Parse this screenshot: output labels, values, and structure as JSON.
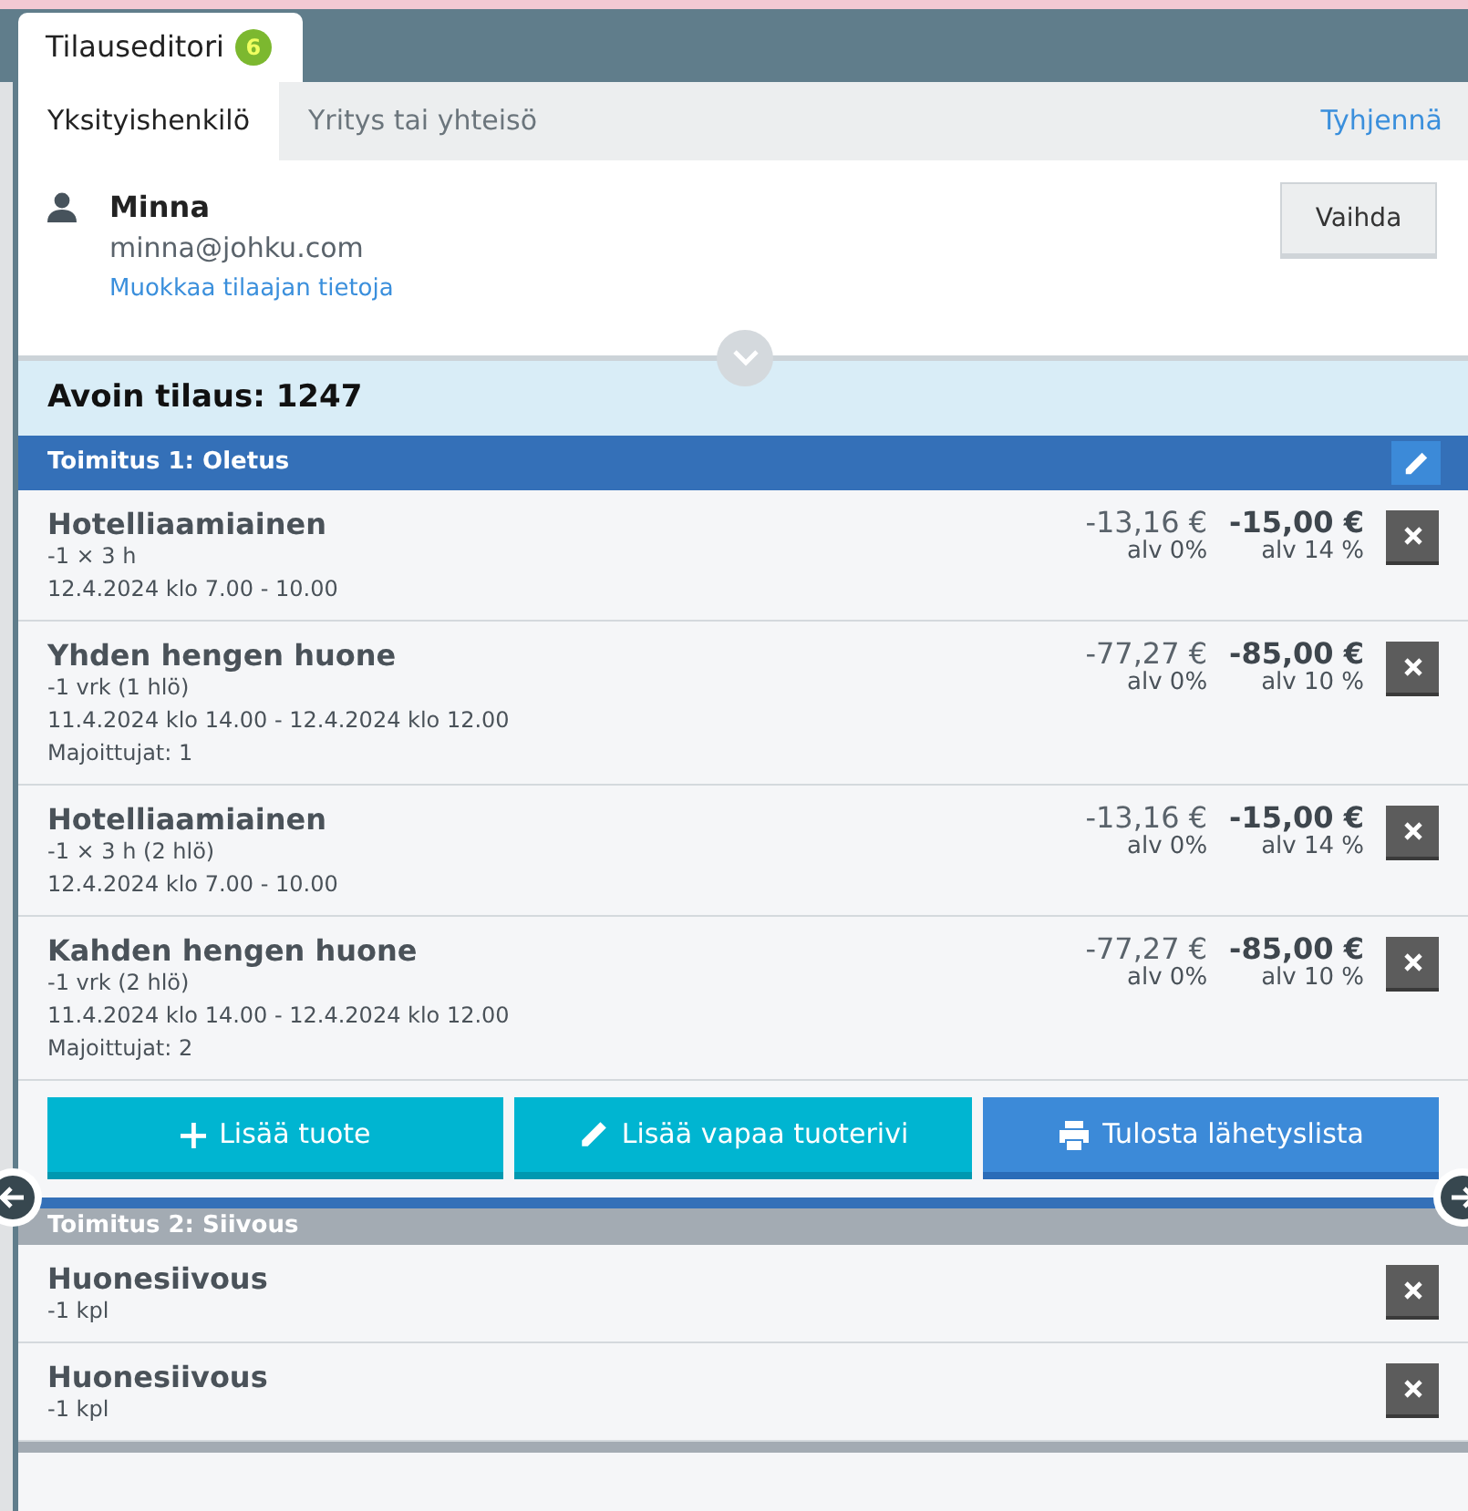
{
  "window_tab": {
    "title": "Tilauseditori",
    "badge": "6"
  },
  "customer_tabs": [
    {
      "label": "Yksityishenkilö",
      "selected": true
    },
    {
      "label": "Yritys tai yhteisö",
      "selected": false
    }
  ],
  "clear_link": "Tyhjennä",
  "customer": {
    "name": "Minna",
    "email": "minna@johku.com",
    "edit_link": "Muokkaa tilaajan tietoja",
    "change_button": "Vaihda"
  },
  "order_title": "Avoin tilaus: 1247",
  "deliveries": [
    {
      "title": "Toimitus 1: Oletus",
      "active": true,
      "items": [
        {
          "name": "Hotelliaamiainen",
          "details": [
            "-1 × 3 h",
            "12.4.2024 klo 7.00 - 10.00"
          ],
          "net_price": "-13,16 €",
          "net_vat": "alv 0%",
          "gross_price": "-15,00 €",
          "gross_vat": "alv 14 %"
        },
        {
          "name": "Yhden hengen huone",
          "details": [
            "-1 vrk (1 hlö)",
            "11.4.2024 klo 14.00 - 12.4.2024 klo 12.00",
            "Majoittujat: 1"
          ],
          "net_price": "-77,27 €",
          "net_vat": "alv 0%",
          "gross_price": "-85,00 €",
          "gross_vat": "alv 10 %"
        },
        {
          "name": "Hotelliaamiainen",
          "details": [
            "-1 × 3 h (2 hlö)",
            "12.4.2024 klo 7.00 - 10.00"
          ],
          "net_price": "-13,16 €",
          "net_vat": "alv 0%",
          "gross_price": "-15,00 €",
          "gross_vat": "alv 14 %"
        },
        {
          "name": "Kahden hengen huone",
          "details": [
            "-1 vrk (2 hlö)",
            "11.4.2024 klo 14.00 - 12.4.2024 klo 12.00",
            "Majoittujat: 2"
          ],
          "net_price": "-77,27 €",
          "net_vat": "alv 0%",
          "gross_price": "-85,00 €",
          "gross_vat": "alv 10 %"
        }
      ],
      "actions": [
        {
          "kind": "add",
          "label": "Lisää tuote"
        },
        {
          "kind": "free",
          "label": "Lisää vapaa tuoterivi"
        },
        {
          "kind": "print",
          "label": "Tulosta lähetyslista"
        }
      ]
    },
    {
      "title": "Toimitus 2: Siivous",
      "active": false,
      "items": [
        {
          "name": "Huonesiivous",
          "details": [
            "-1 kpl"
          ]
        },
        {
          "name": "Huonesiivous",
          "details": [
            "-1 kpl"
          ]
        }
      ]
    }
  ]
}
